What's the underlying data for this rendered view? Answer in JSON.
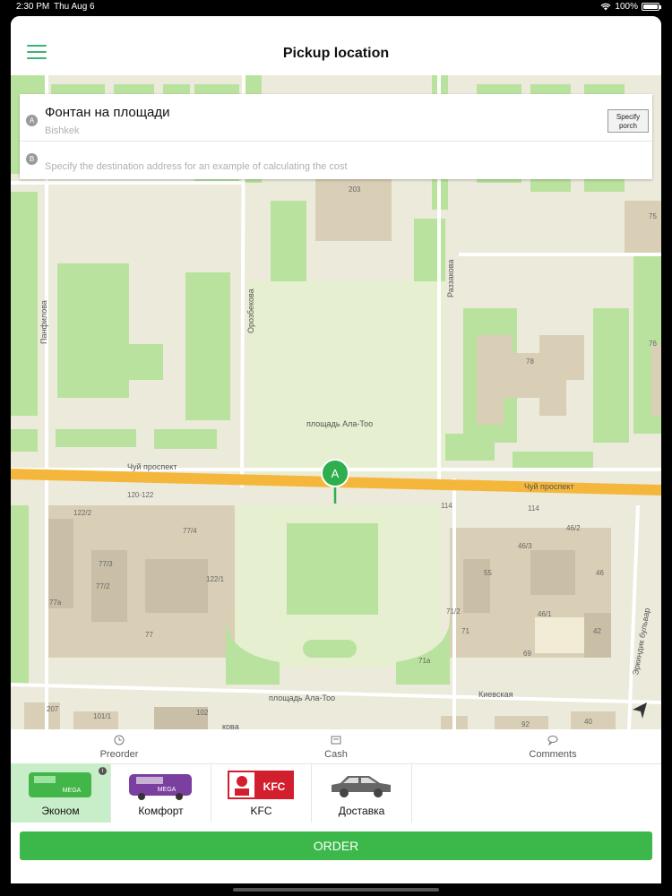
{
  "status_bar": {
    "time": "2:30 PM",
    "date": "Thu Aug 6",
    "battery": "100%"
  },
  "header": {
    "title": "Pickup location"
  },
  "address": {
    "point_a_badge": "A",
    "point_a_main": "Фонтан на площади",
    "point_a_city": "Bishkek",
    "specify_porch_label": "Specify porch",
    "point_b_badge": "B",
    "point_b_placeholder": "Specify the destination address for an example of calculating the cost"
  },
  "map": {
    "pin_label": "A",
    "labels": {
      "square": "площадь Ала-Тоо",
      "square_bottom": "площадь Ала-Тоо",
      "chui_left": "Чуй проспект",
      "chui_right": "Чуй проспект",
      "kievskaya": "Киевская",
      "orozbekova": "Орозбекова",
      "razzakova": "Раззакова",
      "panfilova": "Панфилова",
      "erkindik": "Эркиндик бульвар",
      "kova": "кова"
    },
    "building_numbers": [
      "203",
      "75",
      "78",
      "76",
      "120-122",
      "122/2",
      "77/4",
      "77/3",
      "77/2",
      "77a",
      "122/1",
      "77",
      "114",
      "114",
      "46/3",
      "46/2",
      "55",
      "46",
      "71/2",
      "46/1",
      "71",
      "42",
      "69",
      "71a",
      "207",
      "101/1",
      "102",
      "92",
      "40"
    ]
  },
  "options": [
    {
      "label": "Preorder",
      "icon": "clock-icon"
    },
    {
      "label": "Cash",
      "icon": "wallet-icon"
    },
    {
      "label": "Comments",
      "icon": "chat-icon"
    }
  ],
  "tariffs": [
    {
      "label": "Эконом",
      "selected": true
    },
    {
      "label": "Комфорт",
      "selected": false
    },
    {
      "label": "KFC",
      "selected": false
    },
    {
      "label": "Доставка",
      "selected": false
    }
  ],
  "car_texts": {
    "mega": "MEGA",
    "kfc": "KFC",
    "info": "i"
  },
  "order_label": "ORDER",
  "colors": {
    "accent": "#3cb84a",
    "selected_tariff_bg": "#c8eec9",
    "road": "#f5b73b"
  }
}
